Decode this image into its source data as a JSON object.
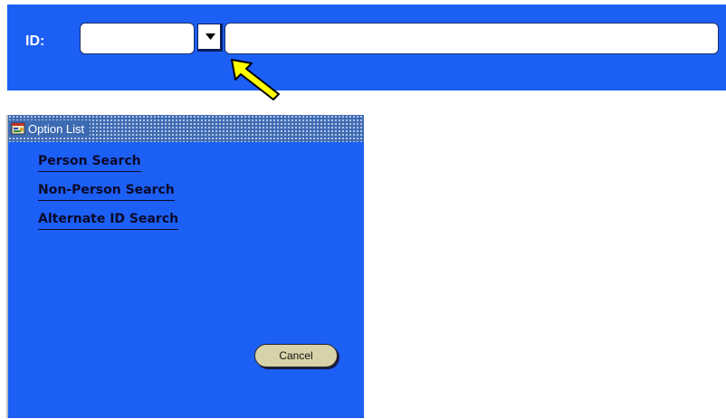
{
  "form": {
    "id_label": "ID:",
    "id_value": "",
    "name_value": "",
    "dropdown_icon": "triangle-down-icon",
    "pointer_icon": "yellow-arrow-icon"
  },
  "option_list": {
    "title": "Option List",
    "title_icon": "app-window-icon",
    "items": [
      {
        "label": "Person Search"
      },
      {
        "label": "Non-Person Search"
      },
      {
        "label": "Alternate ID Search"
      }
    ],
    "cancel_label": "Cancel"
  },
  "colors": {
    "form_background": "#1c5ff5",
    "pointer_arrow": "#ffff00",
    "cancel_button": "#d7d2a8",
    "title_bar": "#3d6bb3"
  }
}
